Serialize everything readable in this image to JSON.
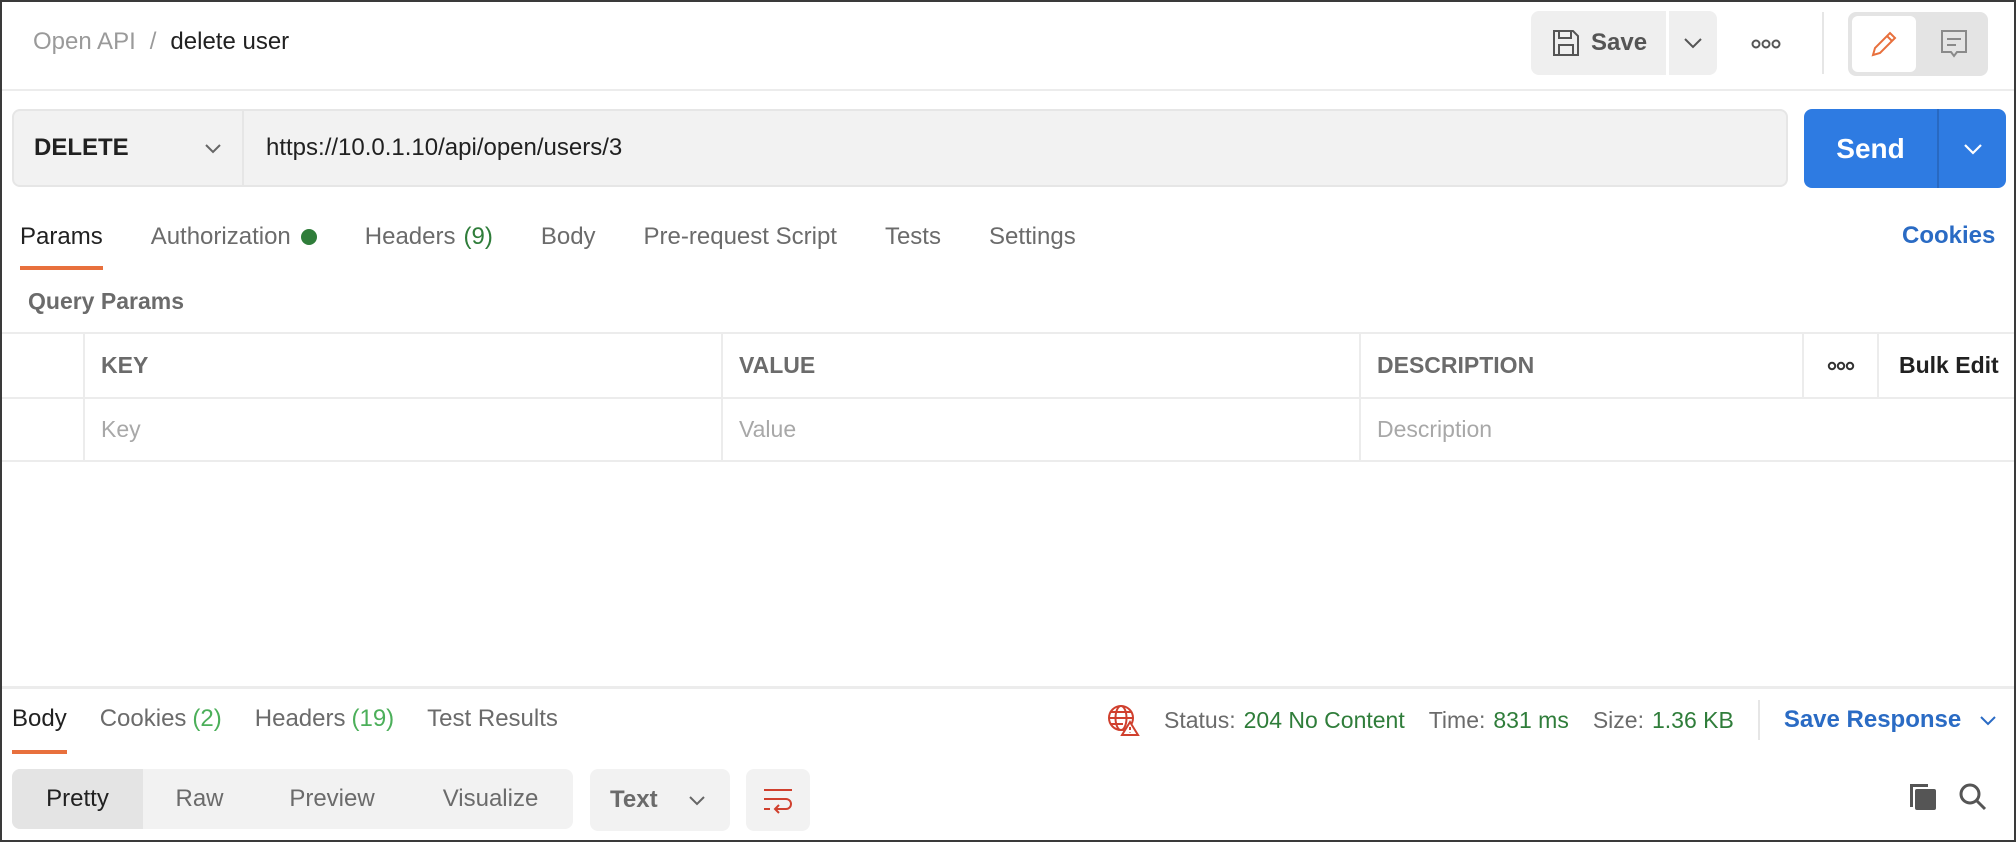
{
  "header": {
    "breadcrumb_parent": "Open API",
    "breadcrumb_separator": "/",
    "breadcrumb_current": "delete user",
    "save_label": "Save",
    "icons": {
      "save": "floppy-disk-icon",
      "save_dropdown": "chevron-down-icon",
      "more": "more-horizontal-icon",
      "edit_mode": "pencil-icon",
      "comment_mode": "comment-icon"
    }
  },
  "request": {
    "method": "DELETE",
    "url": "https://10.0.1.10/api/open/users/3",
    "send_label": "Send"
  },
  "request_tabs": [
    {
      "label": "Params",
      "active": true
    },
    {
      "label": "Authorization",
      "indicator": "green-dot"
    },
    {
      "label": "Headers",
      "count": "(9)"
    },
    {
      "label": "Body"
    },
    {
      "label": "Pre-request Script"
    },
    {
      "label": "Tests"
    },
    {
      "label": "Settings"
    }
  ],
  "cookies_link": "Cookies",
  "query_params": {
    "title": "Query Params",
    "columns": [
      "KEY",
      "VALUE",
      "DESCRIPTION"
    ],
    "bulk_edit_label": "Bulk Edit",
    "placeholders": {
      "key": "Key",
      "value": "Value",
      "description": "Description"
    }
  },
  "response": {
    "tabs": [
      {
        "label": "Body",
        "active": true
      },
      {
        "label": "Cookies",
        "count": "(2)"
      },
      {
        "label": "Headers",
        "count": "(19)"
      },
      {
        "label": "Test Results"
      }
    ],
    "status_label": "Status:",
    "status_value": "204 No Content",
    "time_label": "Time:",
    "time_value": "831 ms",
    "size_label": "Size:",
    "size_value": "1.36 KB",
    "save_response_label": "Save Response",
    "view_modes": [
      "Pretty",
      "Raw",
      "Preview",
      "Visualize"
    ],
    "active_view_mode": "Pretty",
    "format": "Text"
  },
  "colors": {
    "accent_orange": "#e8703d",
    "send_blue": "#2e7be2",
    "link_blue": "#2a6bc4",
    "success_green": "#2f7d3a",
    "warning_red": "#d0402e"
  }
}
